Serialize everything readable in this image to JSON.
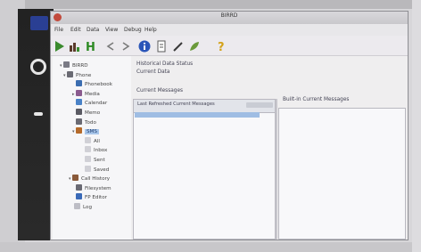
{
  "window": {
    "title": "BIRRD"
  },
  "menubar": {
    "items": [
      "File",
      "Edit",
      "Data",
      "View",
      "Debug",
      "Help"
    ]
  },
  "toolbar": {
    "buttons": [
      {
        "name": "run-icon",
        "color": "#3a8a2e"
      },
      {
        "name": "chart-icon",
        "color": "#5a3a2a"
      },
      {
        "name": "h-icon",
        "color": "#2d8a24"
      },
      {
        "name": "arrow-left-icon",
        "color": "#7a7a7a"
      },
      {
        "name": "arrow-right-icon",
        "color": "#7a7a7a"
      },
      {
        "name": "info-icon",
        "color": "#2a55b8"
      },
      {
        "name": "document-icon",
        "color": "#5a5a5a"
      },
      {
        "name": "pen-icon",
        "color": "#3a3a3a"
      },
      {
        "name": "leaf-icon",
        "color": "#6a9a3a"
      },
      {
        "name": "help-icon",
        "color": "#d4a21a"
      }
    ]
  },
  "tree": {
    "items": [
      {
        "label": "BIRRD",
        "icon_color": "#7a7a85",
        "exp": "▾"
      },
      {
        "label": "Phone",
        "icon_color": "#6a6a73",
        "exp": "▾"
      },
      {
        "label": "Phonebook",
        "icon_color": "#3b6db0",
        "exp": ""
      },
      {
        "label": "Media",
        "icon_color": "#8a5a8e",
        "exp": "▸"
      },
      {
        "label": "Calendar",
        "icon_color": "#4a82c7",
        "exp": ""
      },
      {
        "label": "Memo",
        "icon_color": "#5a5a63",
        "exp": ""
      },
      {
        "label": "Todo",
        "icon_color": "#6a6a73",
        "exp": ""
      },
      {
        "label": "SMS",
        "icon_color": "#b56a2a",
        "exp": "▾"
      },
      {
        "label": "All",
        "icon_color": "#d0d0d6",
        "exp": ""
      },
      {
        "label": "Inbox",
        "icon_color": "#d0d0d6",
        "exp": ""
      },
      {
        "label": "Sent",
        "icon_color": "#d0d0d6",
        "exp": ""
      },
      {
        "label": "Saved",
        "icon_color": "#d0d0d6",
        "exp": ""
      },
      {
        "label": "Call History",
        "icon_color": "#8a5a3a",
        "exp": "▾"
      },
      {
        "label": "Filesystem",
        "icon_color": "#6a6a73",
        "exp": ""
      },
      {
        "label": "FP Editor",
        "icon_color": "#3a6ab8",
        "exp": ""
      },
      {
        "label": "Log",
        "icon_color": "#bdbdc5",
        "exp": ""
      }
    ],
    "selected_label": "SMS"
  },
  "content": {
    "section_title": "Historical Data Status",
    "section_sub": "Current Data",
    "list_title": "Current Messages",
    "list_col1": "Last Refreshed Current Messages",
    "right_title": "Built-in Current Messages"
  }
}
